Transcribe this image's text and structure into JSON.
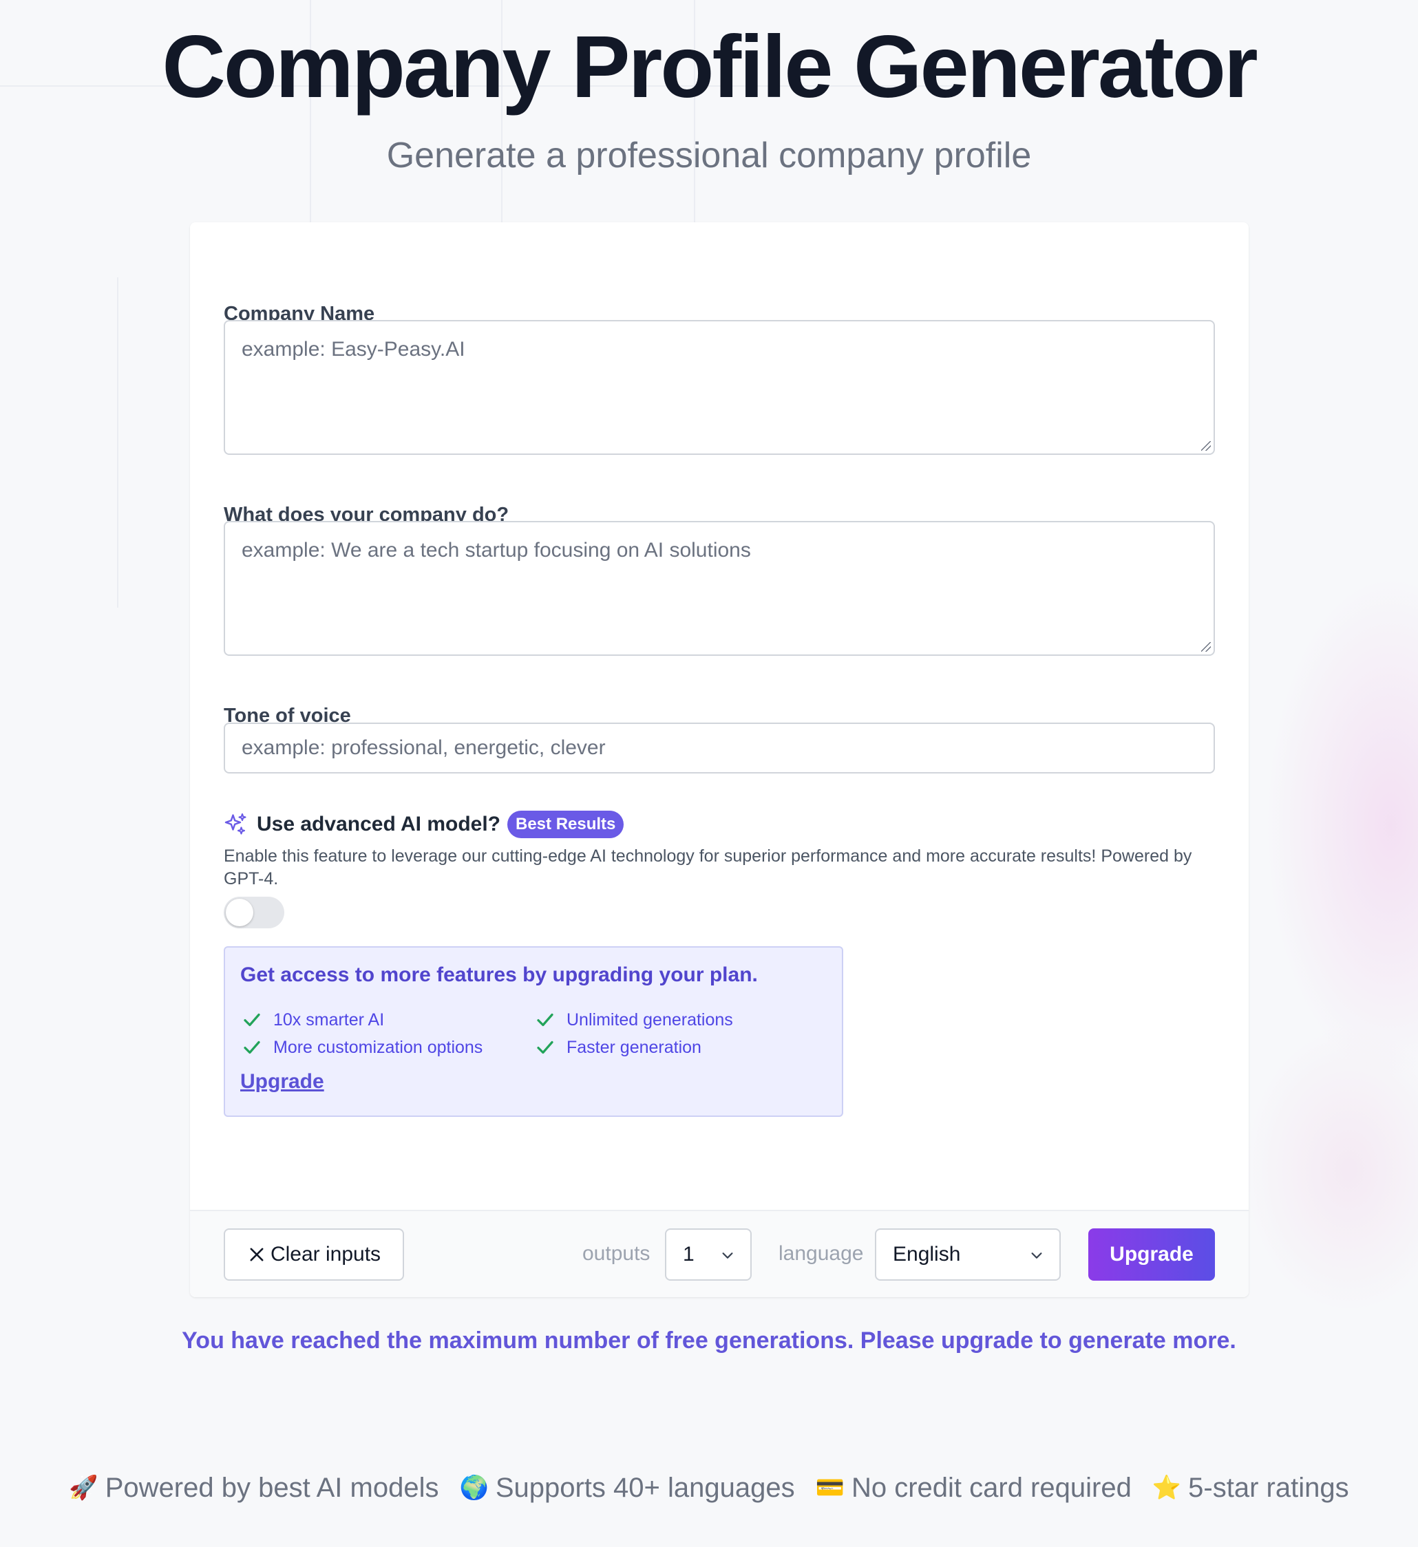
{
  "header": {
    "title": "Company Profile Generator",
    "subtitle": "Generate a professional company profile"
  },
  "form": {
    "company_name": {
      "label": "Company Name",
      "placeholder": "example: Easy-Peasy.AI",
      "value": ""
    },
    "company_do": {
      "label": "What does your company do?",
      "placeholder": "example: We are a tech startup focusing on AI solutions",
      "value": ""
    },
    "tone": {
      "label": "Tone of voice",
      "placeholder": "example: professional, energetic, clever",
      "value": ""
    },
    "advanced": {
      "label": "Use advanced AI model?",
      "badge": "Best Results",
      "description": "Enable this feature to leverage our cutting-edge AI technology for superior performance and more accurate results! Powered by GPT-4.",
      "enabled": false,
      "icon": "sparkles-icon"
    }
  },
  "upsell": {
    "title": "Get access to more features by upgrading your plan.",
    "features": [
      "10x smarter AI",
      "Unlimited generations",
      "More customization options",
      "Faster generation"
    ],
    "link": "Upgrade"
  },
  "footer": {
    "clear_label": "Clear inputs",
    "outputs_label": "outputs",
    "outputs_value": "1",
    "language_label": "language",
    "language_value": "English",
    "upgrade_label": "Upgrade"
  },
  "limit_message": "You have reached the maximum number of free generations. Please upgrade to generate more.",
  "perks": [
    {
      "emoji": "🚀",
      "text": "Powered by best AI models"
    },
    {
      "emoji": "🌍",
      "text": "Supports 40+ languages"
    },
    {
      "emoji": "💳",
      "text": "No credit card required"
    },
    {
      "emoji": "⭐",
      "text": "5-star ratings"
    }
  ],
  "colors": {
    "accent": "#6a5ae6",
    "upgrade_gradient_start": "#8b3be8",
    "upgrade_gradient_end": "#5b4ee6",
    "check": "#22a35a"
  }
}
